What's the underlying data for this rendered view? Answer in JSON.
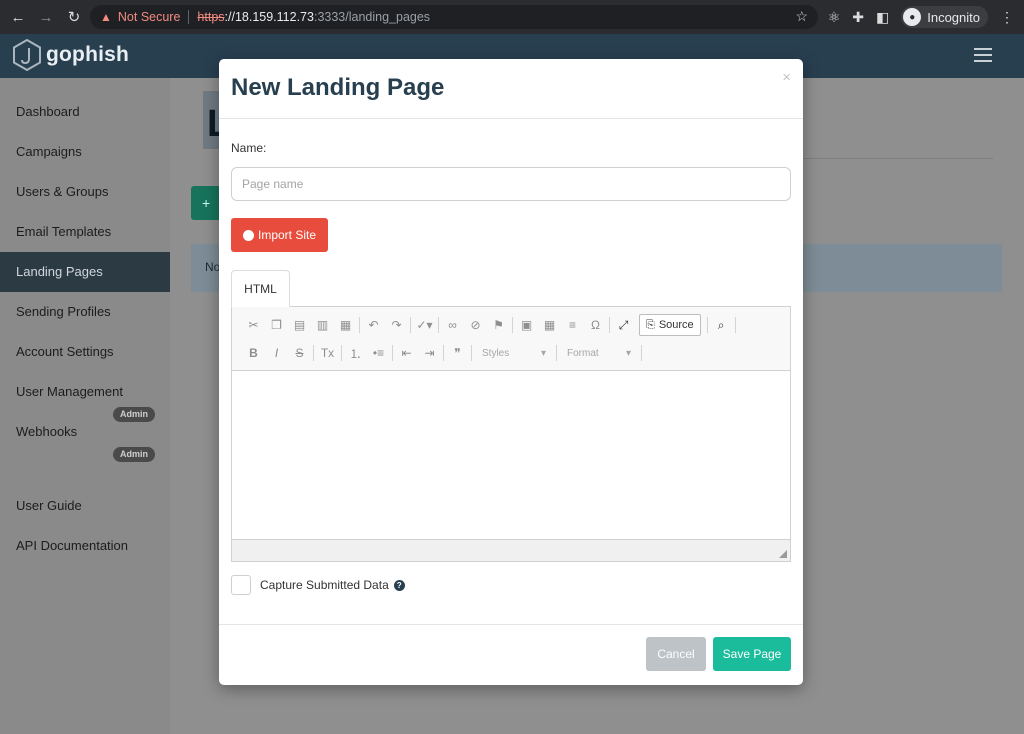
{
  "browser": {
    "warning": "Not Secure",
    "url_scheme": "https",
    "url_host": "://18.159.112.73",
    "url_path": ":3333/landing_pages",
    "profile": "Incognito"
  },
  "app": {
    "brand": "gophish"
  },
  "sidebar": {
    "items": [
      {
        "label": "Dashboard"
      },
      {
        "label": "Campaigns"
      },
      {
        "label": "Users & Groups"
      },
      {
        "label": "Email Templates"
      },
      {
        "label": "Landing Pages"
      },
      {
        "label": "Sending Profiles"
      },
      {
        "label": "Account Settings"
      },
      {
        "label": "User Management"
      },
      {
        "label": "Webhooks"
      },
      {
        "label": "User Guide"
      },
      {
        "label": "API Documentation"
      }
    ],
    "badges": [
      "Admin",
      "Admin"
    ]
  },
  "background": {
    "title_char": "L",
    "alert_text": "No"
  },
  "modal": {
    "title": "New Landing Page",
    "close_symbol": "×",
    "name_label": "Name:",
    "name_placeholder": "Page name",
    "name_value": "",
    "import_label": "Import Site",
    "tab_label": "HTML",
    "source_label": "Source",
    "styles_label": "Styles",
    "format_label": "Format",
    "capture_label": "Capture Submitted Data",
    "help_symbol": "?",
    "cancel_label": "Cancel",
    "save_label": "Save Page"
  },
  "colors": {
    "navbar": "#283f50",
    "import_button": "#e74c3c",
    "save_button": "#1abc9c",
    "cancel_button": "#bdc3c7"
  }
}
